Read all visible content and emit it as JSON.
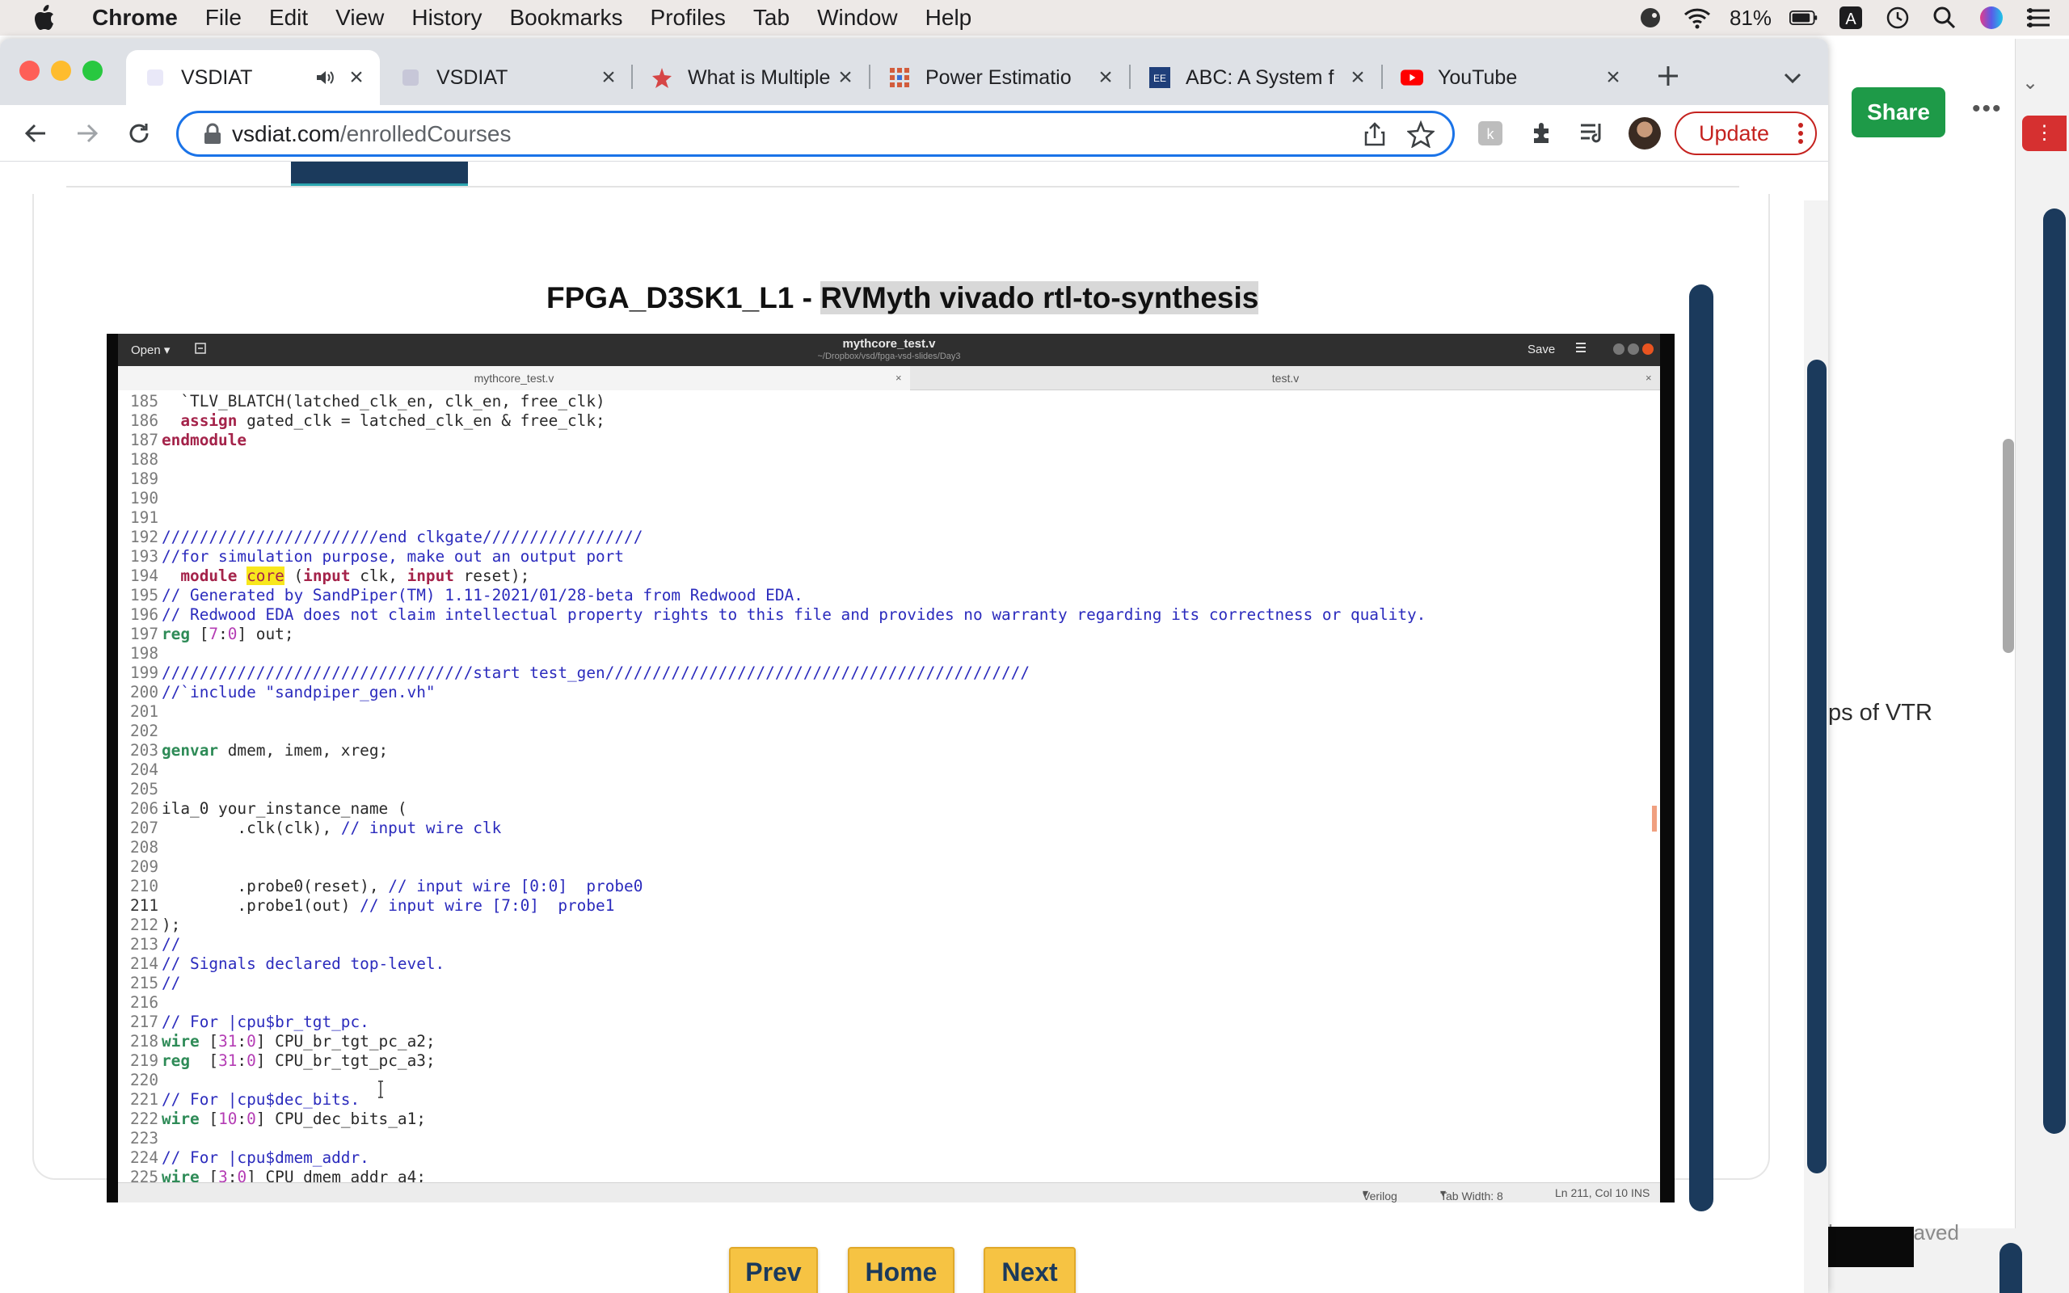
{
  "menubar": {
    "app": "Chrome",
    "items": [
      "File",
      "Edit",
      "View",
      "History",
      "Bookmarks",
      "Profiles",
      "Tab",
      "Window",
      "Help"
    ],
    "battery": "81%"
  },
  "tabs": [
    {
      "title": "VSDIAT",
      "active": true
    },
    {
      "title": "VSDIAT"
    },
    {
      "title": "What is Multiple"
    },
    {
      "title": "Power Estimatio"
    },
    {
      "title": "ABC: A System f"
    },
    {
      "title": "YouTube"
    }
  ],
  "omnibox": {
    "host": "vsdiat.com",
    "path": "/enrolledCourses"
  },
  "toolbar": {
    "update_label": "Update"
  },
  "lesson": {
    "title_prefix": "FPGA_D3SK1_L1 - ",
    "title_highlight": "RVMyth vivado rtl-to-synthesis"
  },
  "editor": {
    "open_label": "Open",
    "window_title": "mythcore_test.v",
    "window_path": "~/Dropbox/vsd/fpga-vsd-slides/Day3",
    "save_label": "Save",
    "tabs": [
      "mythcore_test.v",
      "test.v"
    ],
    "status": {
      "language": "Verilog",
      "tab_width": "Tab Width: 8",
      "position": "Ln 211, Col 10",
      "mode": "INS"
    },
    "lines": [
      {
        "n": "185",
        "code": "  `TLV_BLATCH(latched_clk_en, clk_en, free_clk)"
      },
      {
        "n": "186",
        "code": "  assign gated_clk = latched_clk_en & free_clk;"
      },
      {
        "n": "187",
        "code": "endmodule"
      },
      {
        "n": "188",
        "code": ""
      },
      {
        "n": "189",
        "code": ""
      },
      {
        "n": "190",
        "code": ""
      },
      {
        "n": "191",
        "code": ""
      },
      {
        "n": "192",
        "code": "///////////////////////end clkgate/////////////////"
      },
      {
        "n": "193",
        "code": "//for simulation purpose, make out an output port"
      },
      {
        "n": "194",
        "code": "  module core (input clk, input reset);"
      },
      {
        "n": "195",
        "code": "// Generated by SandPiper(TM) 1.11-2021/01/28-beta from Redwood EDA."
      },
      {
        "n": "196",
        "code": "// Redwood EDA does not claim intellectual property rights to this file and provides no warranty regarding its correctness or quality."
      },
      {
        "n": "197",
        "code": "reg [7:0] out;"
      },
      {
        "n": "198",
        "code": ""
      },
      {
        "n": "199",
        "code": "/////////////////////////////////start test_gen/////////////////////////////////////////////"
      },
      {
        "n": "200",
        "code": "//`include \"sandpiper_gen.vh\""
      },
      {
        "n": "201",
        "code": ""
      },
      {
        "n": "202",
        "code": ""
      },
      {
        "n": "203",
        "code": "genvar dmem, imem, xreg;"
      },
      {
        "n": "204",
        "code": ""
      },
      {
        "n": "205",
        "code": ""
      },
      {
        "n": "206",
        "code": "ila_0 your_instance_name ("
      },
      {
        "n": "207",
        "code": "        .clk(clk), // input wire clk"
      },
      {
        "n": "208",
        "code": ""
      },
      {
        "n": "209",
        "code": ""
      },
      {
        "n": "210",
        "code": "        .probe0(reset), // input wire [0:0]  probe0"
      },
      {
        "n": "211",
        "code": "        .probe1(out) // input wire [7:0]  probe1"
      },
      {
        "n": "212",
        "code": ");"
      },
      {
        "n": "213",
        "code": "//"
      },
      {
        "n": "214",
        "code": "// Signals declared top-level."
      },
      {
        "n": "215",
        "code": "//"
      },
      {
        "n": "216",
        "code": ""
      },
      {
        "n": "217",
        "code": "// For |cpu$br_tgt_pc."
      },
      {
        "n": "218",
        "code": "wire [31:0] CPU_br_tgt_pc_a2;"
      },
      {
        "n": "219",
        "code": "reg  [31:0] CPU_br_tgt_pc_a3;"
      },
      {
        "n": "220",
        "code": ""
      },
      {
        "n": "221",
        "code": "// For |cpu$dec_bits."
      },
      {
        "n": "222",
        "code": "wire [10:0] CPU_dec_bits_a1;"
      },
      {
        "n": "223",
        "code": ""
      },
      {
        "n": "224",
        "code": "// For |cpu$dmem_addr."
      },
      {
        "n": "225",
        "code": "wire [3:0] CPU_dmem_addr_a4;"
      }
    ]
  },
  "buttons": {
    "prev": "Prev",
    "home": "Home",
    "next": "Next"
  },
  "background_app": {
    "share_label": "Share",
    "text": "ps of VTR",
    "status": "hanges saved"
  },
  "colors": {
    "accent_navy": "#1b3a5c",
    "button_yellow": "#f6c343",
    "share_green": "#1e9a48",
    "update_red": "#c5221f"
  }
}
